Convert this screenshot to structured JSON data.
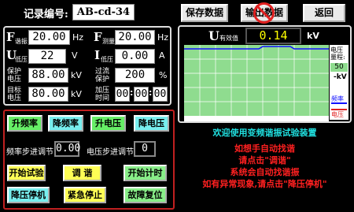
{
  "header": {
    "record_label": "记录编号:",
    "record_value": "AB-cd-34",
    "save_label": "保存数据",
    "output_label": "输出数据",
    "back_label": "返回"
  },
  "params": {
    "f_adjust": {
      "symbol": "F",
      "sub": "谐振",
      "value": "20.00",
      "unit": "Hz"
    },
    "f_measure": {
      "symbol": "F",
      "sub": "测量",
      "value": "20.00",
      "unit": "Hz"
    },
    "u_low": {
      "symbol": "U",
      "sub": "低压",
      "value": "22",
      "unit": "V"
    },
    "i_low": {
      "symbol": "I",
      "sub": "低压",
      "value": "0.00",
      "unit": "A"
    },
    "protect_voltage": {
      "label1": "保护",
      "label2": "电压",
      "value": "88.00",
      "unit": "kV"
    },
    "overflow_protect": {
      "label1": "过流",
      "label2": "保护",
      "value": "200",
      "unit": "%"
    },
    "target_voltage": {
      "label1": "目标",
      "label2": "电压",
      "value": "80.00",
      "unit": "kV"
    },
    "boost_time": {
      "label1": "加压",
      "label2": "时间",
      "hh": "00",
      "mm": "00",
      "ss": "00"
    }
  },
  "display": {
    "symbol": "U",
    "sub": "有效值",
    "value": "0.14",
    "unit": "kV",
    "range_label1": "电压",
    "range_label2": "量程:",
    "range_max": "50",
    "range_min": "-kV",
    "freq_label": "频率",
    "volt_label": "电压"
  },
  "controls": {
    "freq_up": "升频率",
    "freq_down": "降频率",
    "volt_up": "升电压",
    "volt_down": "降电压",
    "freq_step_label": "频率步进调节",
    "freq_step_value": "0.00",
    "volt_step_label": "电压步进调节",
    "volt_step_value": "0",
    "start_test": "开始试验",
    "tune": "调 谐",
    "start_timer": "开始计时",
    "step_down_stop": "降压停机",
    "emergency_stop": "紧急停止",
    "fault_reset": "故障复位"
  },
  "messages": {
    "welcome": "欢迎使用变频谐振试验装置",
    "line1": "如想手自动找谐",
    "line2": "请点击\"调谐\"",
    "line3": "系统会自动找谐振",
    "line4": "如有异常现象,请点击\"降压停机\""
  },
  "colors": {
    "chart_bg": "#8fdc8f",
    "freq_trace": "#1010ff",
    "volt_trace": "#e02020",
    "value_text": "#ffff00"
  }
}
